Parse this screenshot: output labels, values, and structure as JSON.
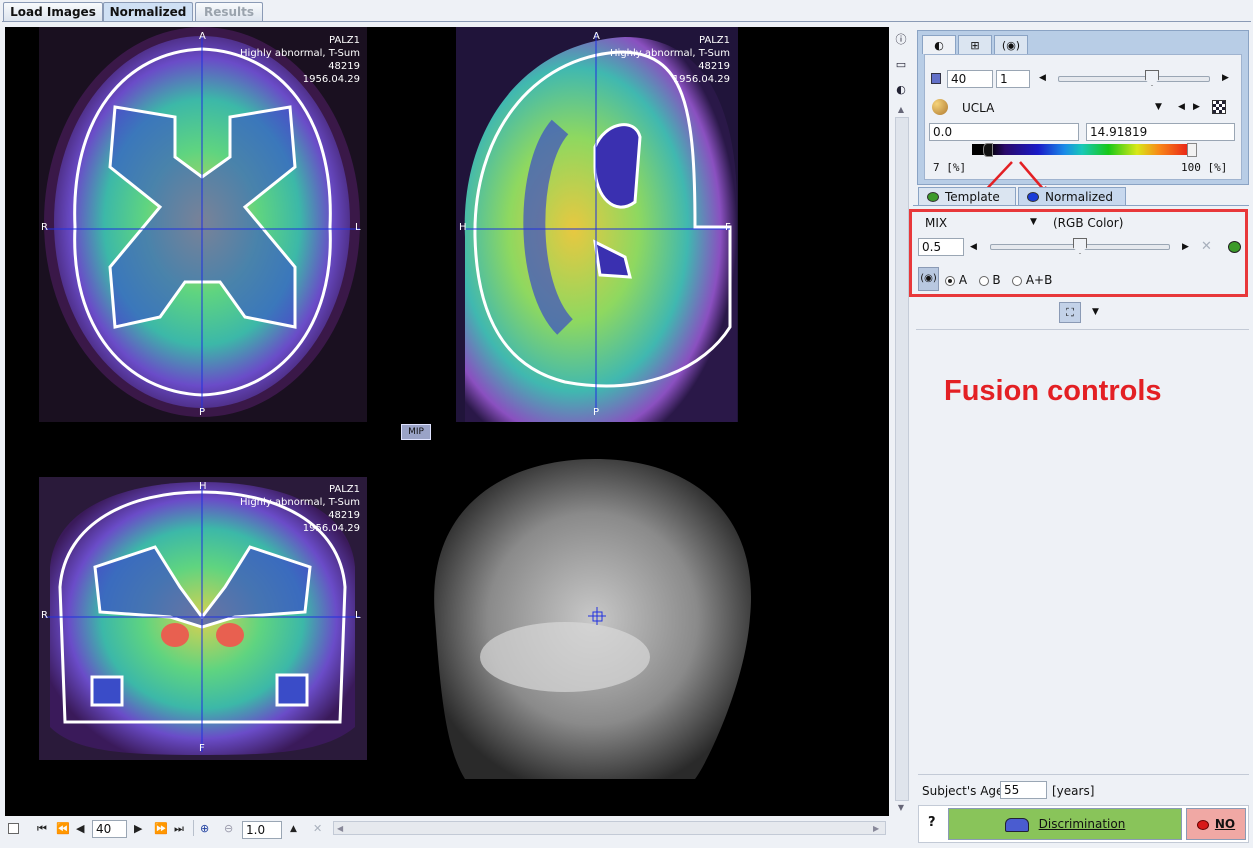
{
  "tabs": [
    {
      "label": "Load Images"
    },
    {
      "label": "Normalized"
    },
    {
      "label": "Results"
    }
  ],
  "viewer": {
    "info": {
      "name": "PALZ1",
      "desc": "Highly abnormal, T-Sum 48219",
      "date": "1956.04.29"
    },
    "axial": {
      "top": "A",
      "bottom": "P",
      "left": "R",
      "right": "L"
    },
    "sagittal": {
      "top": "A",
      "bottom": "P",
      "left": "H",
      "right": "F"
    },
    "coronal": {
      "top": "H",
      "bottom": "F",
      "left": "R",
      "right": "L"
    },
    "mip_label": "MIP"
  },
  "color_panel": {
    "slice_value": "40",
    "step_value": "1",
    "colormap": "UCLA",
    "min_value": "0.0",
    "max_value": "14.91819",
    "lower_pct": "7 [%]",
    "upper_pct": "100 [%]",
    "slider_level": 0.62
  },
  "fusion_tabs": [
    {
      "label": "Template",
      "color": "#3c9a2a"
    },
    {
      "label": "Normalized",
      "color": "#1a3cd8"
    }
  ],
  "fusion": {
    "mode": "MIX",
    "mode_desc": "(RGB Color)",
    "ratio": "0.5",
    "ratio_level": 0.5,
    "radio_a": "A",
    "radio_b": "B",
    "radio_ab": "A+B"
  },
  "annotation": "Fusion controls",
  "age": {
    "label": "Subject's Age",
    "value": "55",
    "unit": "[years]"
  },
  "actions": {
    "help": "?",
    "discrimination": "Discrimination",
    "no": "NO"
  },
  "toolbar": {
    "slice": "40",
    "zoom": "1.0"
  }
}
